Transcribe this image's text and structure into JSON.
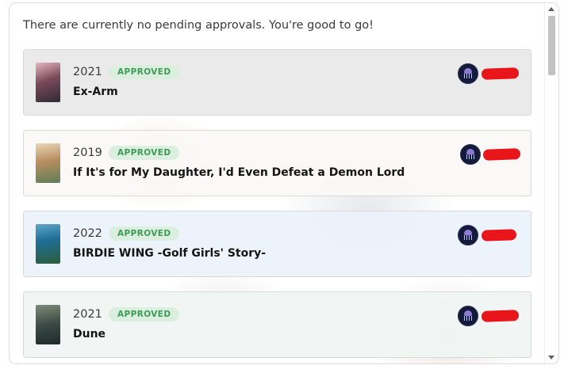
{
  "message": "There are currently no pending approvals. You're good to go!",
  "items": [
    {
      "year": "2021",
      "status": "APPROVED",
      "title": "Ex-Arm"
    },
    {
      "year": "2019",
      "status": "APPROVED",
      "title": "If It's for My Daughter, I'd Even Defeat a Demon Lord"
    },
    {
      "year": "2022",
      "status": "APPROVED",
      "title": "BIRDIE WING -Golf Girls' Story-"
    },
    {
      "year": "2021",
      "status": "APPROVED",
      "title": "Dune"
    }
  ],
  "icons": {
    "user_avatar": "user-avatar-icon",
    "scroll_up": "scroll-up-arrow-icon",
    "scroll_down": "scroll-down-arrow-icon"
  },
  "colors": {
    "badge_bg": "#dbefdf",
    "badge_text": "#3f9a58",
    "redaction": "#e8161a"
  }
}
